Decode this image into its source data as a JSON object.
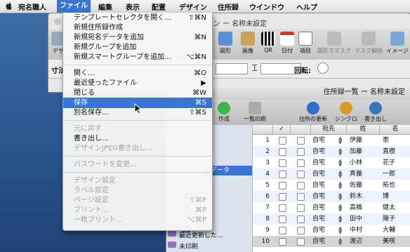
{
  "menubar": {
    "apple_icon": "apple-icon",
    "items": [
      {
        "label": "宛名職人"
      },
      {
        "label": "ファイル"
      },
      {
        "label": "編集"
      },
      {
        "label": "表示"
      },
      {
        "label": "配置"
      },
      {
        "label": "デザイン"
      },
      {
        "label": "住所録"
      },
      {
        "label": "ウインドウ"
      },
      {
        "label": "ヘルプ"
      }
    ]
  },
  "design_window": {
    "title": "デザイン ー 名称未設定",
    "toolbar": [
      {
        "label": "デザ",
        "icon": "design-icon"
      },
      {
        "label": "図形",
        "icon": "shape-icon"
      },
      {
        "label": "画像",
        "icon": "image-icon"
      },
      {
        "label": "QR",
        "icon": "qr-icon"
      },
      {
        "label": "日付",
        "icon": "calendar-icon"
      },
      {
        "label": "項目",
        "icon": "field-icon"
      },
      {
        "label": "図形でマスク",
        "icon": "mask-icon"
      },
      {
        "label": "マスク解除",
        "icon": "unmask-icon"
      },
      {
        "label": "イメージ",
        "icon": "image-view-icon"
      }
    ],
    "form_label_left": "寸法",
    "rotation_label": "回転:"
  },
  "address_window": {
    "title": "住所録一覧 ー 名称未設定",
    "toolbar": [
      {
        "label": "作成",
        "icon": "add-icon"
      },
      {
        "label": "一覧印刷",
        "icon": "print-icon"
      },
      {
        "label": "住所の更新",
        "icon": "update-icon"
      },
      {
        "label": "シンクロ",
        "icon": "sync-icon"
      },
      {
        "label": "書き出し",
        "icon": "export-icon"
      }
    ],
    "sidebar": {
      "header": "名データ",
      "items": [
        {
          "label": ""
        },
        {
          "label": ""
        },
        {
          "label": ""
        },
        {
          "label": ""
        },
        {
          "label": "最近更新した..."
        },
        {
          "label": "未印刷"
        }
      ]
    },
    "columns": [
      "✓",
      "宛先",
      "姓",
      "名"
    ],
    "rows": [
      {
        "num": "1",
        "dest": "自宅",
        "last": "伊藤",
        "first": "恵"
      },
      {
        "num": "2",
        "dest": "自宅",
        "last": "加藤",
        "first": "直樹"
      },
      {
        "num": "3",
        "dest": "自宅",
        "last": "小林",
        "first": "花子"
      },
      {
        "num": "4",
        "dest": "自宅",
        "last": "斉藤",
        "first": "一郎"
      },
      {
        "num": "5",
        "dest": "自宅",
        "last": "佐藤",
        "first": "拓也"
      },
      {
        "num": "6",
        "dest": "自宅",
        "last": "鈴木",
        "first": "博"
      },
      {
        "num": "7",
        "dest": "自宅",
        "last": "高橋",
        "first": "健太"
      },
      {
        "num": "8",
        "dest": "自宅",
        "last": "田中",
        "first": "陽子"
      },
      {
        "num": "9",
        "dest": "自宅",
        "last": "中村",
        "first": "大輔"
      },
      {
        "num": "10",
        "dest": "自宅",
        "last": "渡辺",
        "first": "美咲"
      }
    ]
  },
  "file_menu": {
    "items": [
      {
        "type": "item",
        "label": "テンプレートセレクタを開く...",
        "shortcut": "⇧⌘N",
        "disabled": false,
        "highlighted": false
      },
      {
        "type": "item",
        "label": "新規住所録作成",
        "shortcut": "",
        "disabled": false,
        "highlighted": false
      },
      {
        "type": "item",
        "label": "新規宛名データを追加",
        "shortcut": "⌘N",
        "disabled": false,
        "highlighted": false
      },
      {
        "type": "item",
        "label": "新規グループを追加",
        "shortcut": "",
        "disabled": false,
        "highlighted": false
      },
      {
        "type": "item",
        "label": "新規スマートグループを追加...",
        "shortcut": "⌥⌘N",
        "disabled": false,
        "highlighted": false
      },
      {
        "type": "sep"
      },
      {
        "type": "item",
        "label": "開く...",
        "shortcut": "⌘O",
        "disabled": false,
        "highlighted": false
      },
      {
        "type": "item",
        "label": "最近使ったファイル",
        "shortcut": "▶",
        "disabled": false,
        "highlighted": false
      },
      {
        "type": "item",
        "label": "閉じる",
        "shortcut": "⌘W",
        "disabled": false,
        "highlighted": false
      },
      {
        "type": "item",
        "label": "保存",
        "shortcut": "⌘S",
        "disabled": false,
        "highlighted": true
      },
      {
        "type": "item",
        "label": "別名保存...",
        "shortcut": "⇧⌘S",
        "disabled": false,
        "highlighted": false
      },
      {
        "type": "sep"
      },
      {
        "type": "item",
        "label": "元に戻す",
        "shortcut": "",
        "disabled": true,
        "highlighted": false
      },
      {
        "type": "item",
        "label": "書き出し...",
        "shortcut": "",
        "disabled": false,
        "highlighted": false
      },
      {
        "type": "item",
        "label": "デザインJPEG書き出し...",
        "shortcut": "",
        "disabled": true,
        "highlighted": false
      },
      {
        "type": "sep"
      },
      {
        "type": "item",
        "label": "パスワードを変更...",
        "shortcut": "",
        "disabled": true,
        "highlighted": false
      },
      {
        "type": "sep"
      },
      {
        "type": "item",
        "label": "デザイン設定",
        "shortcut": "",
        "disabled": true,
        "highlighted": false
      },
      {
        "type": "item",
        "label": "ラベル設定",
        "shortcut": "",
        "disabled": true,
        "highlighted": false
      },
      {
        "type": "item",
        "label": "ページ設定",
        "shortcut": "⇧⌘P",
        "disabled": true,
        "highlighted": false
      },
      {
        "type": "item",
        "label": "プリント...",
        "shortcut": "⌘P",
        "disabled": true,
        "highlighted": false
      },
      {
        "type": "item",
        "label": "一枚プリント...",
        "shortcut": "⌥⌘P",
        "disabled": true,
        "highlighted": false
      }
    ]
  },
  "colors": {
    "highlight": "#3875d7",
    "disabled_text": "#a6a6a6",
    "desktop": "#2e5a93"
  }
}
